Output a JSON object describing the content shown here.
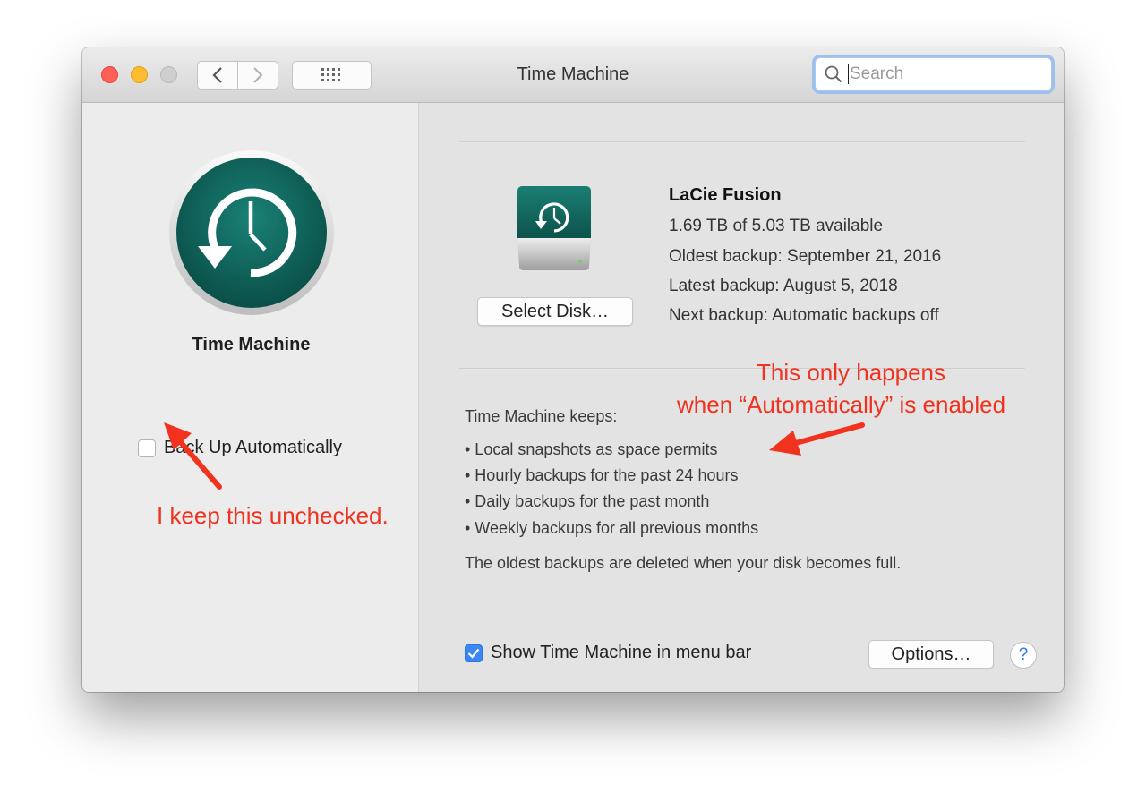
{
  "window": {
    "title": "Time Machine"
  },
  "toolbar": {
    "back_icon": "chevron-left-icon",
    "forward_icon": "chevron-right-icon",
    "grid_icon": "grid-icon"
  },
  "search": {
    "placeholder": "Search",
    "value": ""
  },
  "sidebar": {
    "title": "Time Machine",
    "auto_backup_label": "Back Up Automatically",
    "auto_backup_checked": false
  },
  "disk": {
    "name": "LaCie Fusion",
    "available": "1.69 TB of 5.03 TB available",
    "oldest": "Oldest backup: September 21, 2016",
    "latest": "Latest backup: August 5, 2018",
    "next": "Next backup: Automatic backups off",
    "select_label": "Select Disk…"
  },
  "keeps": {
    "heading": "Time Machine keeps:",
    "items": [
      "• Local snapshots as space permits",
      "• Hourly backups for the past 24 hours",
      "• Daily backups for the past month",
      "• Weekly backups for all previous months"
    ],
    "footer": "The oldest backups are deleted when your disk becomes full."
  },
  "bottom": {
    "menubar_label": "Show Time Machine in menu bar",
    "menubar_checked": true,
    "options_label": "Options…",
    "help_label": "?"
  },
  "annotations": {
    "left": "I keep this unchecked.",
    "right_line1": "This only happens",
    "right_line2": "when “Automatically” is enabled",
    "color": "#f0321e"
  },
  "colors": {
    "icon_teal": "#0f6f66",
    "accent_blue": "#3b87f3",
    "close": "#fe5f57",
    "minimize": "#febc2e"
  }
}
